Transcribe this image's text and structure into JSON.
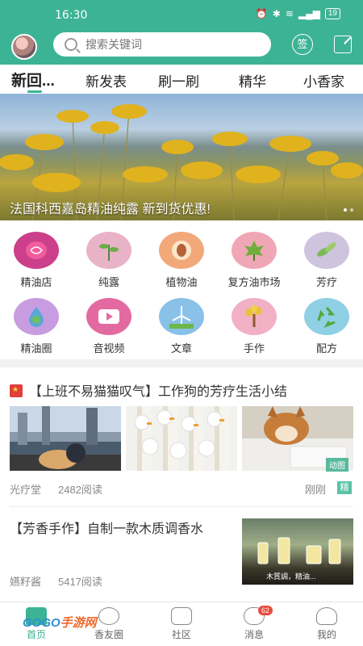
{
  "status_bar": {
    "time": "16:30",
    "battery": "19"
  },
  "header": {
    "search_placeholder": "搜索关键词",
    "sign_label": "签"
  },
  "tabs": [
    {
      "label": "新回..."
    },
    {
      "label": "新发表"
    },
    {
      "label": "刷一刷"
    },
    {
      "label": "精华"
    },
    {
      "label": "小香家"
    }
  ],
  "banner": {
    "caption": "法国科西嘉岛精油纯露 新到货优惠!"
  },
  "categories": [
    {
      "label": "精油店",
      "icon": "rose-icon",
      "bg": "#cc3f8a"
    },
    {
      "label": "纯露",
      "icon": "sprout-icon",
      "bg": "#e9b3c7"
    },
    {
      "label": "植物油",
      "icon": "apricot-icon",
      "bg": "#f2a97a"
    },
    {
      "label": "复方油市场",
      "icon": "maple-leaf-icon",
      "bg": "#f0a7b5"
    },
    {
      "label": "芳疗",
      "icon": "leaves-icon",
      "bg": "#cfc4de"
    },
    {
      "label": "精油圈",
      "icon": "globe-drop-icon",
      "bg": "#c89ce0"
    },
    {
      "label": "音视频",
      "icon": "video-icon",
      "bg": "#e36aa1"
    },
    {
      "label": "文章",
      "icon": "windmill-icon",
      "bg": "#89c1e8"
    },
    {
      "label": "手作",
      "icon": "tree-icon",
      "bg": "#f2b0c4"
    },
    {
      "label": "配方",
      "icon": "recycle-icon",
      "bg": "#8fd0e4"
    }
  ],
  "posts": [
    {
      "title": "【上班不易猫猫叹气】工作狗的芳疗生活小结",
      "author": "光疗堂",
      "reads": "2482阅读",
      "time": "刚刚",
      "tag": "精",
      "thumb_badge": "动图"
    },
    {
      "title": "【芳香手作】自制一款木质调香水",
      "author": "嬿籽酱",
      "reads": "5417阅读",
      "thumb_caption": "木質調，精油..."
    }
  ],
  "bottom_nav": [
    {
      "label": "首页"
    },
    {
      "label": "香友圈"
    },
    {
      "label": "社区"
    },
    {
      "label": "消息",
      "badge": "62"
    },
    {
      "label": "我的"
    }
  ],
  "watermark": {
    "main": "GOGO",
    "sub": "手游网"
  },
  "colors": {
    "brand": "#3db395",
    "badge_red": "#e94b3c"
  }
}
